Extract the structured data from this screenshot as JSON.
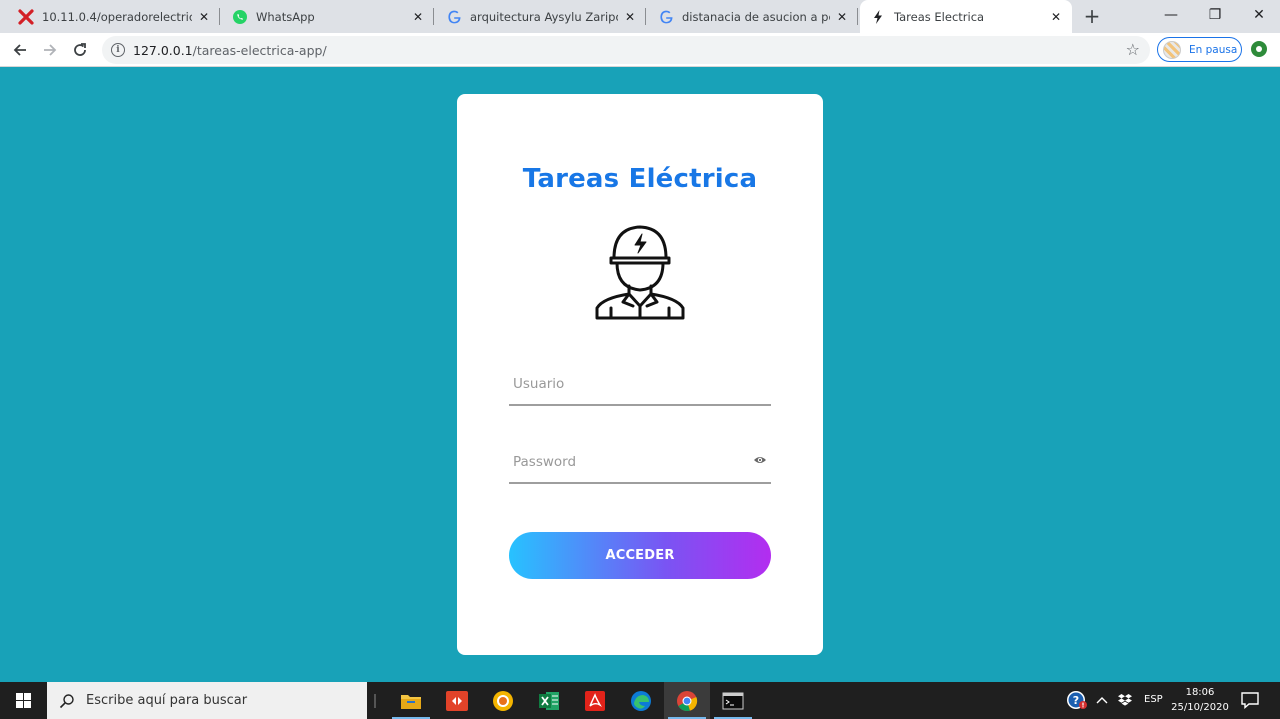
{
  "browser": {
    "tabs": [
      {
        "title": "10.11.0.4/operadorelectrico/lo",
        "icon": "red-x-favicon",
        "active": false
      },
      {
        "title": "WhatsApp",
        "icon": "whatsapp-favicon",
        "active": false
      },
      {
        "title": "arquitectura Aysylu Zaripova -",
        "icon": "google-favicon",
        "active": false
      },
      {
        "title": "distanacia de asucion a pedro j",
        "icon": "google-favicon",
        "active": false
      },
      {
        "title": "Tareas Electrica",
        "icon": "lightning-favicon",
        "active": true
      }
    ],
    "new_tab_label": "+",
    "window_controls": {
      "minimize": "—",
      "restore": "❐",
      "close": "✕"
    },
    "url_host": "127.0.0.1",
    "url_path": "/tareas-electrica-app/",
    "profile_status": "En pausa"
  },
  "page": {
    "title": "Tareas Eléctrica",
    "username_placeholder": "Usuario",
    "password_placeholder": "Password",
    "submit_label": "ACCEDER"
  },
  "taskbar": {
    "search_placeholder": "Escribe aquí para buscar",
    "apps": [
      "file-explorer",
      "git-app",
      "chrome-canary",
      "excel",
      "acrobat",
      "edge",
      "chrome",
      "terminal"
    ],
    "language": "ESP",
    "time": "18:06",
    "date": "25/10/2020"
  },
  "colors": {
    "page_background": "#18a2b8",
    "title_blue": "#1877e6",
    "button_gradient_start": "#27c2ff",
    "button_gradient_end": "#b32df0"
  }
}
